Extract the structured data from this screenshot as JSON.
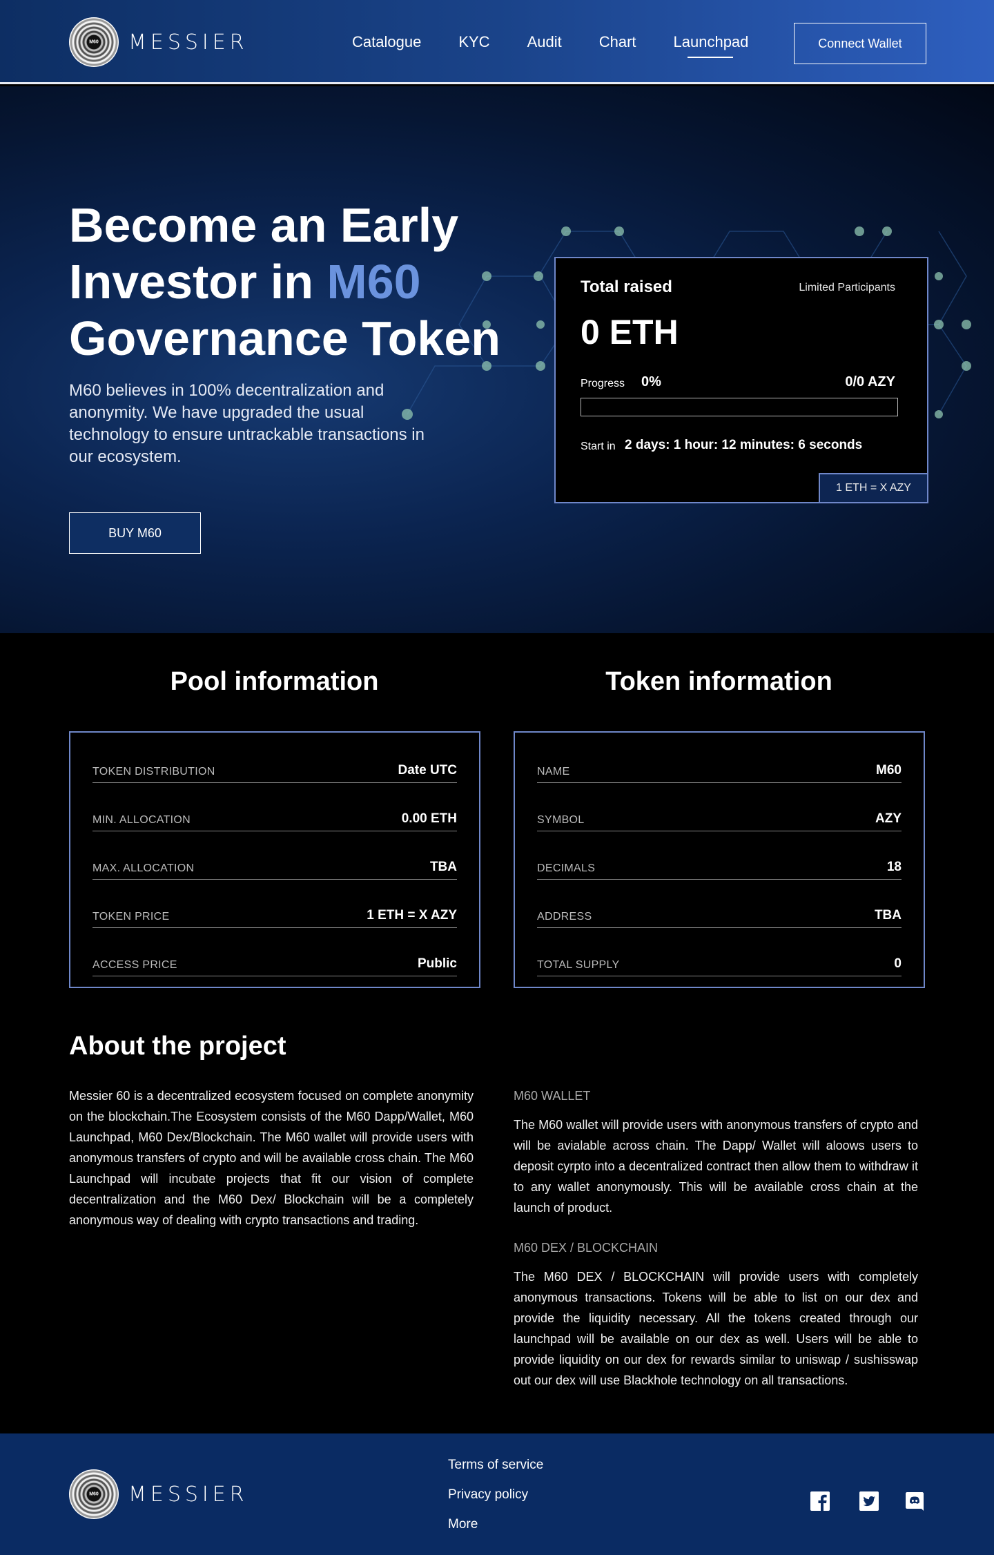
{
  "header": {
    "logo_text": "MESSIER",
    "logo_mark_text": "M60",
    "nav": [
      {
        "label": "Catalogue"
      },
      {
        "label": "KYC"
      },
      {
        "label": "Audit"
      },
      {
        "label": "Chart"
      },
      {
        "label": "Launchpad",
        "active": true
      }
    ],
    "connect_label": "Connect Wallet"
  },
  "hero": {
    "title_line1": "Become an Early",
    "title_line2_pre": "Investor in ",
    "title_line2_accent": "M60",
    "title_line3": "Governance Token",
    "description": "M60 believes in 100% decentralization and anonymity. We have upgraded the usual technology to ensure untrackable transactions in our ecosystem.",
    "buy_label": "BUY M60",
    "accent_color": "#6b93de"
  },
  "raise_card": {
    "title": "Total raised",
    "limited": "Limited Participants",
    "amount": "0 ETH",
    "progress_label": "Progress",
    "progress_percent": "0%",
    "progress_value": 0,
    "progress_tokens": "0/0 AZY",
    "start_label": "Start in",
    "start_value": "2 days: 1 hour: 12 minutes: 6 seconds",
    "rate": "1 ETH = X  AZY"
  },
  "pool": {
    "title": "Pool information",
    "rows": [
      {
        "label": "TOKEN DISTRIBUTION",
        "value": "Date UTC"
      },
      {
        "label": "MIN. ALLOCATION",
        "value": "0.00 ETH"
      },
      {
        "label": "MAX. ALLOCATION",
        "value": "TBA"
      },
      {
        "label": "TOKEN PRICE",
        "value": "1 ETH = X AZY"
      },
      {
        "label": "ACCESS PRICE",
        "value": "Public"
      }
    ]
  },
  "token": {
    "title": "Token information",
    "rows": [
      {
        "label": "NAME",
        "value": "M60"
      },
      {
        "label": "SYMBOL",
        "value": "AZY"
      },
      {
        "label": "DECIMALS",
        "value": "18"
      },
      {
        "label": "ADDRESS",
        "value": "TBA"
      },
      {
        "label": "TOTAL SUPPLY",
        "value": "0"
      }
    ]
  },
  "about": {
    "title": "About the project",
    "text": "Messier 60 is a decentralized ecosystem focused on complete anonymity on the blockchain.The Ecosystem consists of the M60 Dapp/Wallet, M60 Launchpad, M60 Dex/Blockchain. The M60 wallet will provide users with anonymous transfers of crypto and will be available cross chain. The M60 Launchpad will incubate projects that fit our vision of complete decentralization and the M60 Dex/ Blockchain will be a completely anonymous way of dealing with crypto transactions and trading.",
    "wallet_heading": "M60 WALLET",
    "wallet_text": "The M60 wallet will provide users with anonymous transfers of crypto and will be avialable across chain. The Dapp/ Wallet will aloows users to deposit cyrpto into a decentralized contract then allow them to withdraw it to any wallet anonymously. This will be available cross chain at the launch of product.",
    "dex_heading": "M60 DEX / BLOCKCHAIN",
    "dex_text": "The M60 DEX / BLOCKCHAIN will provide users with completely anonymous transactions. Tokens will be able to list on our dex and provide the liquidity necessary. All the tokens created through our launchpad will be available on our dex as well. Users will be able to provide liquidity on our dex for rewards similar to uniswap / sushisswap out our dex will use Blackhole technology on all transactions."
  },
  "footer": {
    "logo_text": "MESSIER",
    "logo_mark_text": "M60",
    "links": [
      "Terms of service",
      "Privacy policy",
      "More"
    ],
    "social": [
      "facebook-icon",
      "twitter-icon",
      "discord-icon"
    ]
  }
}
